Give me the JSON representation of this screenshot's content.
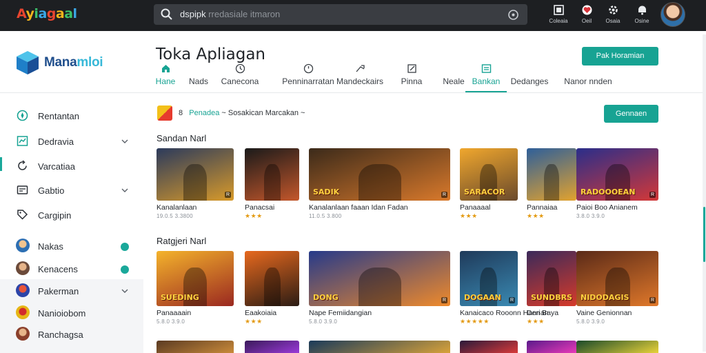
{
  "topbar": {
    "logo_text": "Ayiagaal",
    "search_value": "dspipk",
    "search_suffix": "rredasiale itmaron",
    "nav": [
      {
        "label": "Coleaia",
        "icon": "apps-icon"
      },
      {
        "label": "Oeil",
        "icon": "heart-icon"
      },
      {
        "label": "Osaia",
        "icon": "settings-icon"
      },
      {
        "label": "Osine",
        "icon": "bell-icon"
      }
    ]
  },
  "brand": {
    "name_part1": "Mana",
    "name_part2": "mloi"
  },
  "sidebar": {
    "items": [
      {
        "label": "Rentantan",
        "icon": "compass-icon"
      },
      {
        "label": "Dedravia",
        "icon": "chart-icon"
      },
      {
        "label": "Varcatiaa",
        "icon": "refresh-icon"
      },
      {
        "label": "Gabtio",
        "icon": "card-icon"
      },
      {
        "label": "Cargipin",
        "icon": "tag-icon"
      }
    ],
    "people": [
      {
        "label": "Nakas",
        "color": "#2d6fb3"
      },
      {
        "label": "Kenacens",
        "color": "#6b4a3a"
      },
      {
        "label": "Pakerman",
        "color": "#2c44a8"
      },
      {
        "label": "Nanioiobom",
        "color": "#e6b616"
      },
      {
        "label": "Ranchagsa",
        "color": "#8a3f2b"
      }
    ]
  },
  "main": {
    "title": "Toka Apliagan",
    "primary_button": "Pak Horamian",
    "tabs": [
      {
        "label": "Hane",
        "icon": "home-icon",
        "active": true
      },
      {
        "label": "Nads",
        "icon": "",
        "active": false
      },
      {
        "label": "Canecona",
        "icon": "clock-icon",
        "active": false
      },
      {
        "label": "Penninarratan",
        "icon": "timer-icon",
        "active": false
      },
      {
        "label": "Mandeckairs",
        "icon": "send-icon",
        "active": false
      },
      {
        "label": "Pinna",
        "icon": "edit-icon",
        "active": false
      },
      {
        "label": "Neale",
        "icon": "",
        "active": false
      },
      {
        "label": "Bankan",
        "icon": "grid-icon",
        "active": true
      },
      {
        "label": "Dedanges",
        "icon": "",
        "active": false
      },
      {
        "label": "Nanor nnden",
        "icon": "",
        "active": false
      }
    ],
    "breadcrumb": {
      "num": "8",
      "link": "Penadea",
      "rest": "~ Sosakican  Marcakan ~"
    },
    "section_button": "Gennaen",
    "section1": {
      "title": "Sandan Narl",
      "cards": [
        {
          "title": "Kanalanlaan",
          "meta": "19.0.5 3.3800",
          "stars": 0,
          "badge": "R",
          "art": "",
          "colors": [
            "#2b3a5c",
            "#d89a2a"
          ]
        },
        {
          "title": "Panacsai",
          "meta": "",
          "stars": 3,
          "badge": "",
          "art": "",
          "colors": [
            "#1a1a1a",
            "#c4572b"
          ]
        },
        {
          "title": "Kanalanlaan faaan Idan Fadan",
          "meta": "11.0.5 3.800",
          "stars": 0,
          "badge": "R",
          "art": "SADIK",
          "colors": [
            "#3b2a1a",
            "#d9792b"
          ]
        },
        {
          "title": "Panaaaal",
          "meta": "",
          "stars": 3,
          "badge": "",
          "art": "SARACOR",
          "colors": [
            "#f0a72d",
            "#6a4a2c"
          ]
        },
        {
          "title": "Pannaiaa",
          "meta": "",
          "stars": 3,
          "badge": "",
          "art": "",
          "colors": [
            "#2e5f9a",
            "#e2a22e"
          ]
        },
        {
          "title": "Paioi Boo Anianem",
          "meta": "3.8.0 3.9.0",
          "stars": 0,
          "badge": "R",
          "art": "RADOOOEAN",
          "colors": [
            "#2a2e8a",
            "#d33838"
          ]
        }
      ]
    },
    "section2": {
      "title": "Ratgjeri Narl",
      "cards": [
        {
          "title": "Panaaaain",
          "meta": "5.8.0 3.9.0",
          "stars": 0,
          "badge": "",
          "art": "SUEDING",
          "colors": [
            "#f4b32c",
            "#9a2820"
          ]
        },
        {
          "title": "Eaakoiaia",
          "meta": "",
          "stars": 3,
          "badge": "",
          "art": "",
          "colors": [
            "#e7691e",
            "#2b1c14"
          ]
        },
        {
          "title": "Nape Femiidangian",
          "meta": "5.8.0 3.9.0",
          "stars": 0,
          "badge": "R",
          "art": "DONG",
          "colors": [
            "#263a8a",
            "#ef8a2b"
          ]
        },
        {
          "title": "Kanaicaco Rooonn Hanrian",
          "meta": "",
          "stars": 5,
          "badge": "R",
          "art": "DOGAAN",
          "colors": [
            "#1f3a5a",
            "#3a8ab3"
          ]
        },
        {
          "title": "Den Baya",
          "meta": "",
          "stars": 3,
          "badge": "",
          "art": "SUNDBRS",
          "colors": [
            "#3b2a5a",
            "#d63a2a"
          ]
        },
        {
          "title": "Vaine Genionnan",
          "meta": "5.8.0 3.9.0",
          "stars": 0,
          "badge": "R",
          "art": "NIDODAGIS",
          "colors": [
            "#5a2a18",
            "#e0782a"
          ]
        }
      ]
    }
  }
}
